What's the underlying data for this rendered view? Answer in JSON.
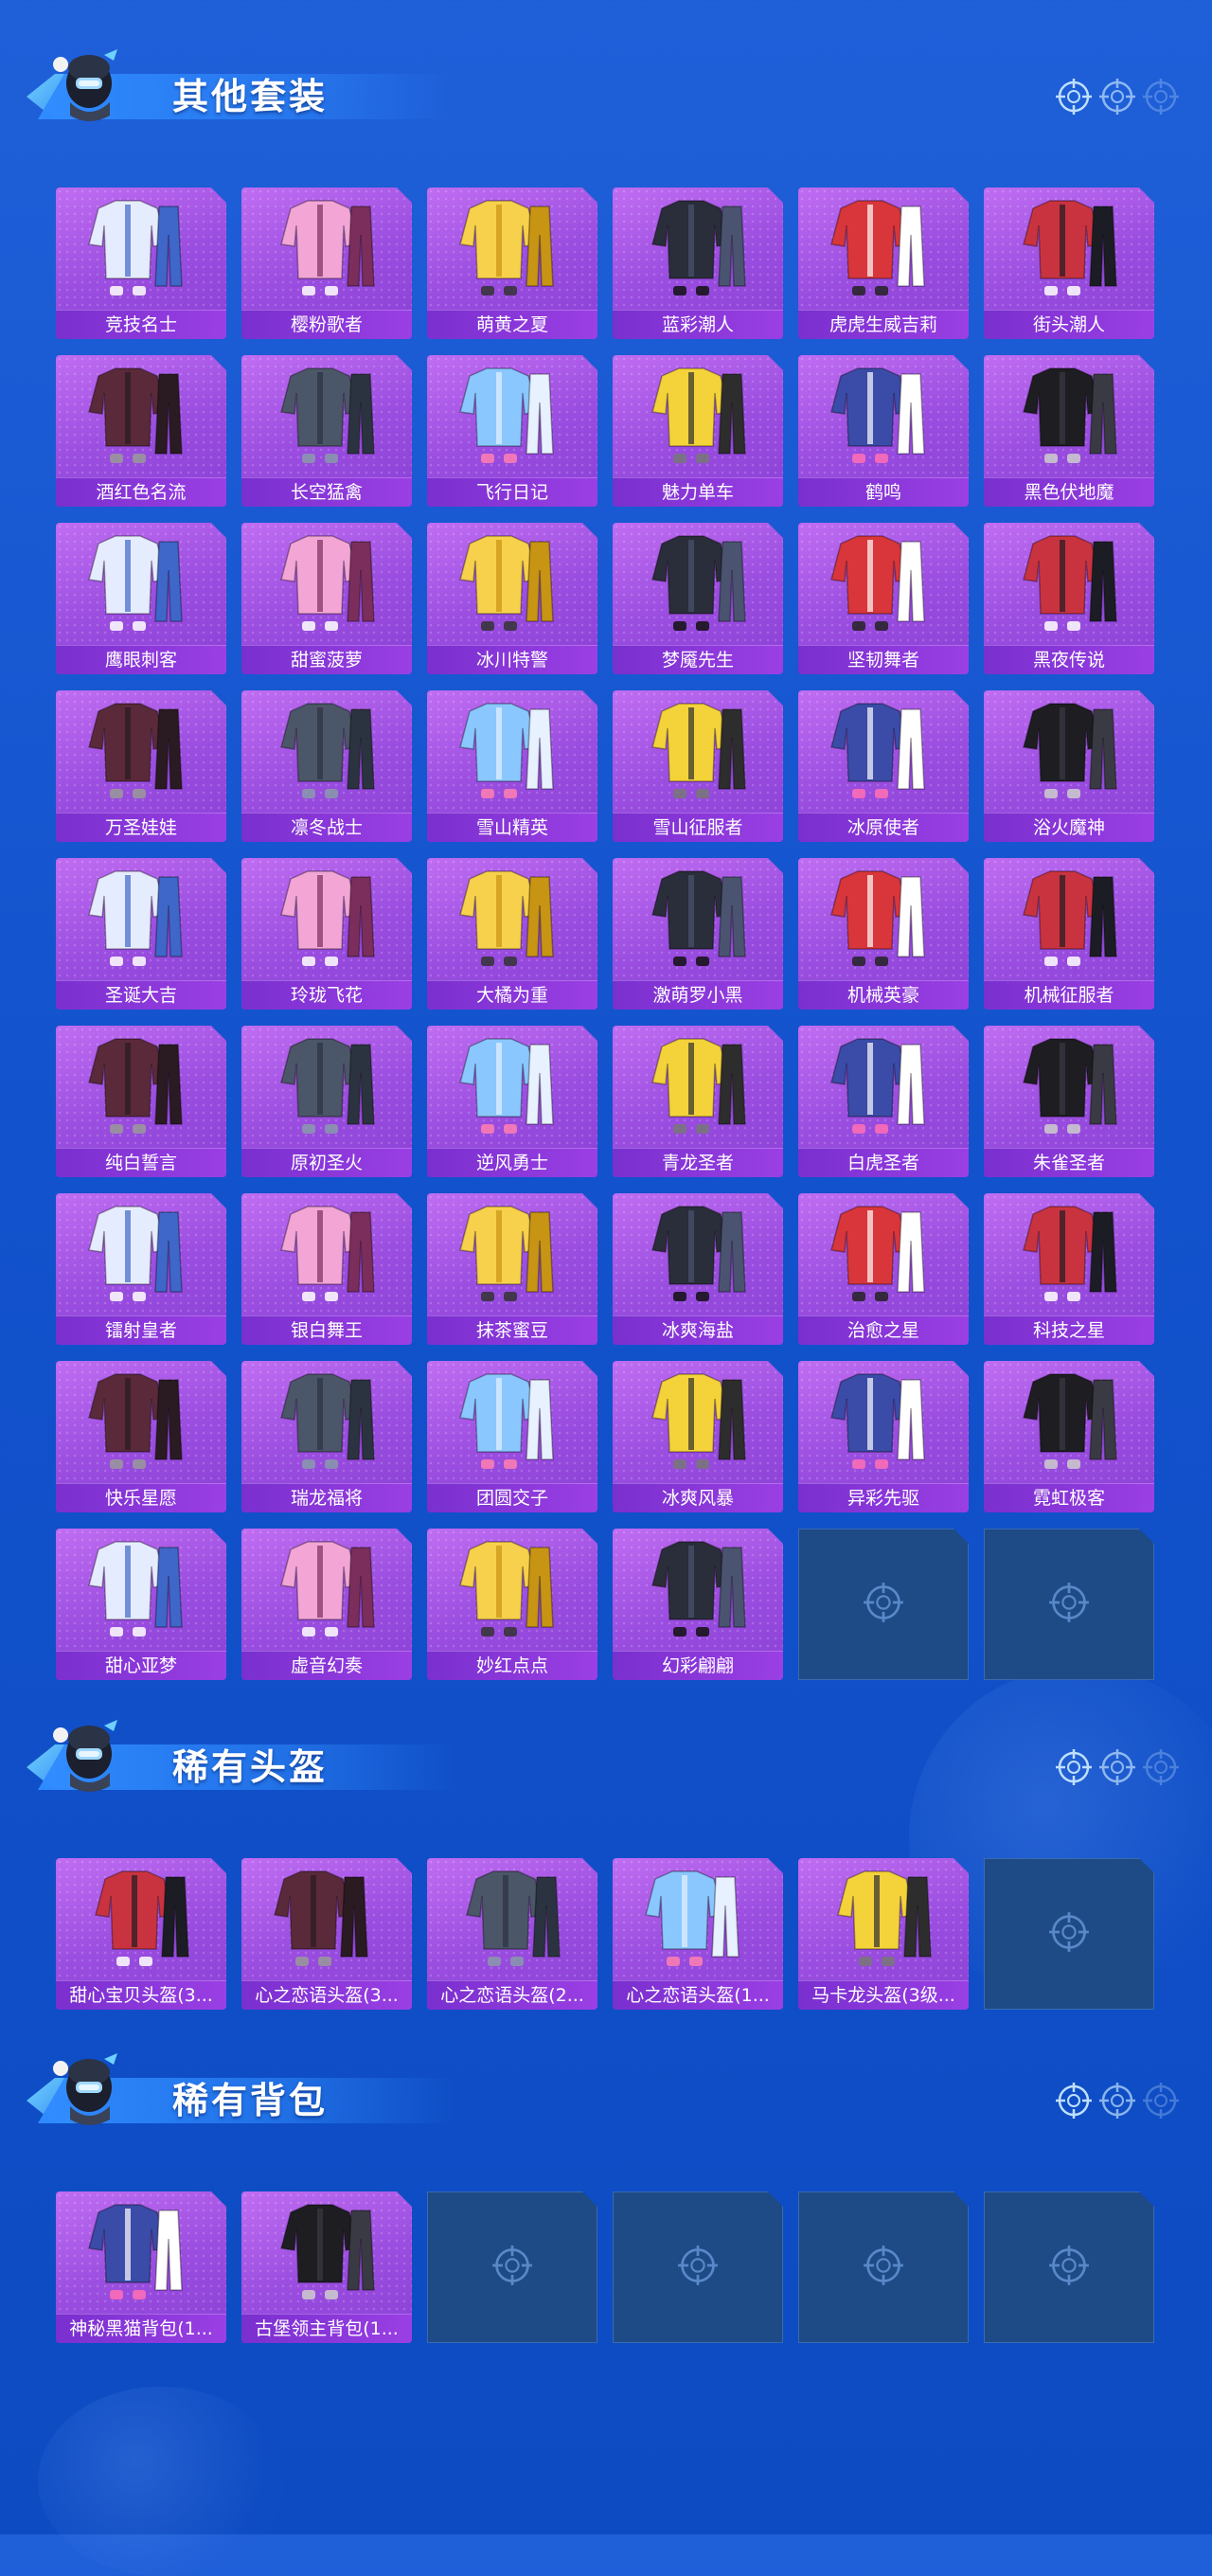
{
  "sections": [
    {
      "title": "其他套装",
      "items": [
        "竞技名士",
        "樱粉歌者",
        "萌黄之夏",
        "蓝彩潮人",
        "虎虎生威吉莉",
        "街头潮人",
        "酒红色名流",
        "长空猛禽",
        "飞行日记",
        "魅力单车",
        "鹤鸣",
        "黑色伏地魔",
        "鹰眼刺客",
        "甜蜜菠萝",
        "冰川特警",
        "梦魇先生",
        "坚韧舞者",
        "黑夜传说",
        "万圣娃娃",
        "凛冬战士",
        "雪山精英",
        "雪山征服者",
        "冰原使者",
        "浴火魔神",
        "圣诞大吉",
        "玲珑飞花",
        "大橘为重",
        "激萌罗小黑",
        "机械英豪",
        "机械征服者",
        "纯白誓言",
        "原初圣火",
        "逆风勇士",
        "青龙圣者",
        "白虎圣者",
        "朱雀圣者",
        "镭射皇者",
        "银白舞王",
        "抹茶蜜豆",
        "冰爽海盐",
        "治愈之星",
        "科技之星",
        "快乐星愿",
        "瑞龙福将",
        "团圆交子",
        "冰爽风暴",
        "异彩先驱",
        "霓虹极客",
        "甜心亚梦",
        "虚音幻奏",
        "妙红点点",
        "幻彩翩翩"
      ],
      "empty_slots": 2
    },
    {
      "title": "稀有头盔",
      "items": [
        "甜心宝贝头盔(3...",
        "心之恋语头盔(3...",
        "心之恋语头盔(2...",
        "心之恋语头盔(1...",
        "马卡龙头盔(3级..."
      ],
      "empty_slots": 1
    },
    {
      "title": "稀有背包",
      "items": [
        "神秘黑猫背包(1...",
        "古堡领主背包(1..."
      ],
      "empty_slots": 4
    }
  ],
  "icons": {
    "mascot": "soldier-mascot-icon",
    "crosshair": "crosshair-icon",
    "empty_slot": "crosshair-icon"
  },
  "colors": {
    "background": "#1252cc",
    "card": "#9b4ee0",
    "card_label": "#7a2fcf",
    "empty_slot": "#1e4a86",
    "title_text": "#ffffff"
  }
}
